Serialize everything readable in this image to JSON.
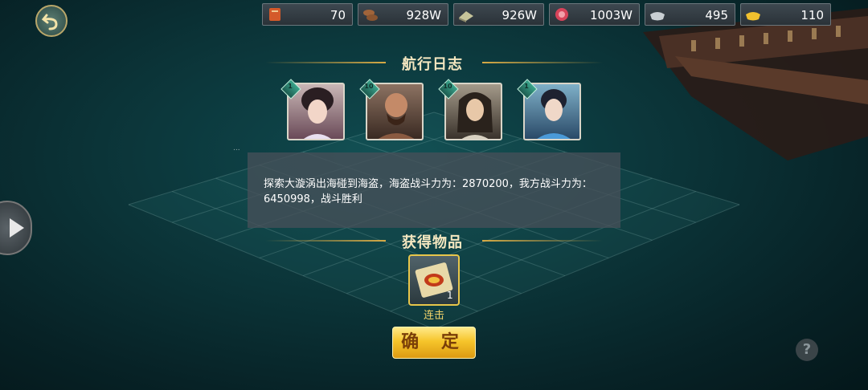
{
  "resources": [
    {
      "icon": "scroll-icon",
      "value": "70"
    },
    {
      "icon": "wood-icon",
      "value": "928W"
    },
    {
      "icon": "stone-icon",
      "value": "926W"
    },
    {
      "icon": "meat-icon",
      "value": "1003W"
    },
    {
      "icon": "silver-icon",
      "value": "495"
    },
    {
      "icon": "gold-ingot-icon",
      "value": "110"
    }
  ],
  "log_title": "航行日志",
  "heroes": [
    {
      "level": "1",
      "portrait": "female-hero-portrait"
    },
    {
      "level": "10",
      "portrait": "bald-warrior-portrait"
    },
    {
      "level": "10",
      "portrait": "longhair-hero-portrait"
    },
    {
      "level": "1",
      "portrait": "blue-robe-hero-portrait"
    }
  ],
  "message": "探索大漩涡出海碰到海盗，海盗战斗力为：2870200，我方战斗力为：6450998，战斗胜利",
  "reward_title": "获得物品",
  "reward": {
    "name": "连击",
    "count": "1"
  },
  "confirm_label": "确 定",
  "help_label": "?",
  "colors": {
    "gold": "#d7aa45",
    "button": "#f6c52b",
    "panel": "#46505a"
  }
}
